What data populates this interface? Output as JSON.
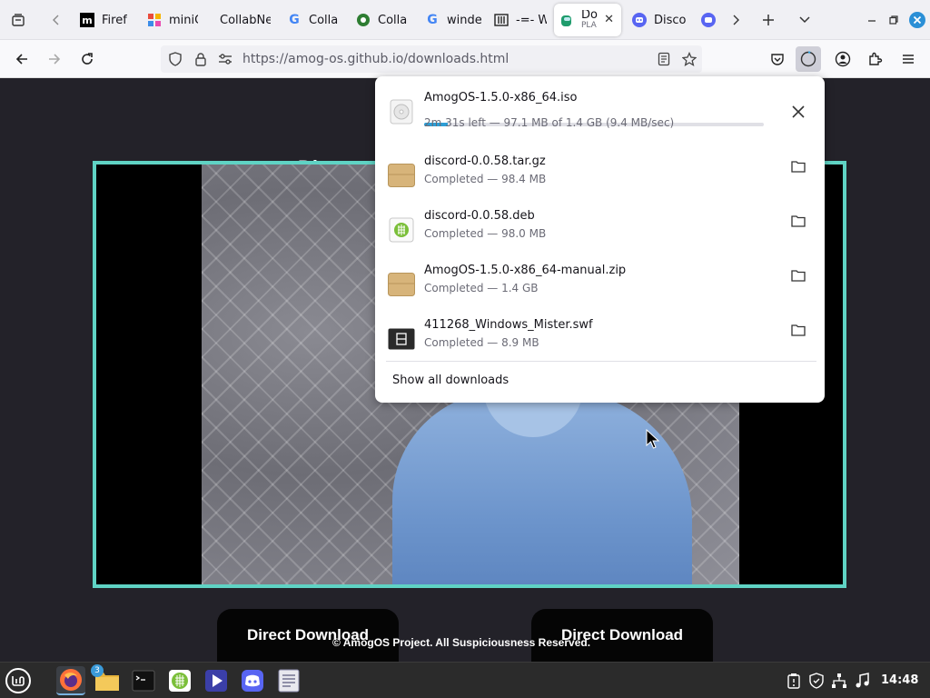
{
  "tabs": [
    {
      "title": "Firef",
      "favicon": "mozilla-m-icon"
    },
    {
      "title": "miniC",
      "favicon": "colorful-squares-icon"
    },
    {
      "title": "CollabNe",
      "favicon": "blank-icon"
    },
    {
      "title": "Colla",
      "favicon": "google-g-icon"
    },
    {
      "title": "Colla",
      "favicon": "green-circle-icon"
    },
    {
      "title": "winde",
      "favicon": "google-g-icon"
    },
    {
      "title": "-=- W",
      "favicon": "wiki-icon"
    },
    {
      "title": "Do",
      "subtitle": "PLA",
      "favicon": "among-us-icon"
    },
    {
      "title": "Disco",
      "favicon": "discord-icon"
    },
    {
      "title": "",
      "favicon": "discord-icon"
    }
  ],
  "address_bar": {
    "url": "https://amog-os.github.io/downloads.html"
  },
  "page": {
    "heading_fragment": "Di",
    "download_buttons": [
      "Direct Download",
      "Direct Download"
    ],
    "footer": "© AmogOS Project. All Suspiciousness Reserved."
  },
  "downloads": {
    "items": [
      {
        "name": "AmogOS-1.5.0-x86_64.iso",
        "status": "2m 31s left — 97.1 MB of 1.4 GB (9.4 MB/sec)",
        "progress_percent": 6.9,
        "icon": "disc-icon",
        "in_progress": true
      },
      {
        "name": "discord-0.0.58.tar.gz",
        "status": "Completed — 98.4 MB",
        "icon": "archive-icon"
      },
      {
        "name": "discord-0.0.58.deb",
        "status": "Completed — 98.0 MB",
        "icon": "deb-package-icon"
      },
      {
        "name": "AmogOS-1.5.0-x86_64-manual.zip",
        "status": "Completed — 1.4 GB",
        "icon": "archive-icon"
      },
      {
        "name": "411268_Windows_Mister.swf",
        "status": "Completed — 8.9 MB",
        "icon": "film-icon"
      }
    ],
    "show_all_label": "Show all downloads"
  },
  "taskbar": {
    "files_badge": "3",
    "clock": "14:48"
  },
  "colors": {
    "accent_teal": "#5fd3c4",
    "progress_blue": "#2d9ed6"
  }
}
